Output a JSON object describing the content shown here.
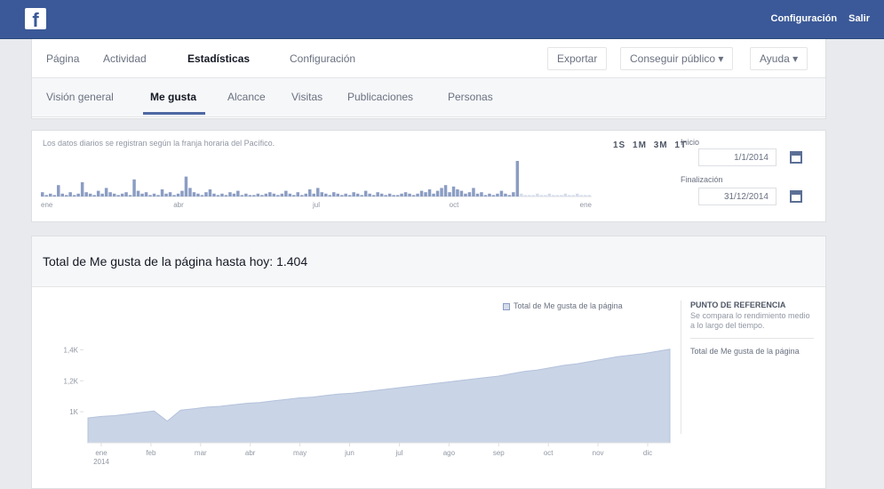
{
  "topbar": {
    "logo_letter": "f",
    "links": [
      "Configuración",
      "Salir"
    ]
  },
  "page_nav": {
    "items": [
      "Página",
      "Actividad",
      "Estadísticas",
      "Configuración"
    ],
    "active": "Estadísticas",
    "buttons": [
      "Exportar",
      "Conseguir público ▾",
      "Ayuda ▾"
    ]
  },
  "insights_tabs": {
    "items": [
      "Visión general",
      "Me gusta",
      "Alcance",
      "Visitas",
      "Publicaciones",
      "Personas"
    ],
    "active": "Me gusta"
  },
  "timeline": {
    "note": "Los datos diarios se registran según la franja horaria del Pacífico.",
    "ranges": [
      "1S",
      "1M",
      "3M",
      "1T"
    ],
    "start_label": "Inicio",
    "start_value": "1/1/2014",
    "end_label": "Finalización",
    "end_value": "31/12/2014",
    "axis_labels": [
      "ene",
      "abr",
      "jul",
      "oct",
      "ene"
    ],
    "daily_values": [
      3,
      1,
      2,
      1,
      8,
      2,
      1,
      3,
      1,
      2,
      10,
      3,
      2,
      1,
      4,
      2,
      6,
      3,
      2,
      1,
      2,
      3,
      1,
      12,
      4,
      2,
      3,
      1,
      2,
      1,
      5,
      2,
      3,
      1,
      2,
      4,
      14,
      6,
      3,
      2,
      1,
      3,
      5,
      2,
      1,
      2,
      1,
      3,
      2,
      4,
      1,
      2,
      1,
      1,
      2,
      1,
      2,
      3,
      2,
      1,
      2,
      4,
      2,
      1,
      3,
      1,
      2,
      5,
      2,
      6,
      3,
      2,
      1,
      3,
      2,
      1,
      2,
      1,
      3,
      2,
      1,
      4,
      2,
      1,
      3,
      2,
      1,
      2,
      1,
      1,
      2,
      3,
      2,
      1,
      2,
      4,
      3,
      5,
      2,
      4,
      6,
      8,
      3,
      7,
      5,
      4,
      2,
      3,
      6,
      2,
      3,
      1,
      2,
      1,
      2,
      4,
      2,
      1,
      3,
      25,
      2,
      1,
      1,
      1,
      2,
      1,
      1,
      2,
      1,
      1,
      1,
      2,
      1,
      1,
      2,
      1,
      1,
      1
    ]
  },
  "main": {
    "title": "Total de Me gusta de la página hasta hoy: 1.404",
    "legend": "Total de Me gusta de la página",
    "side_head": "PUNTO DE REFERENCIA",
    "side_text": "Se compara lo rendimiento medio a lo largo del tiempo.",
    "side_link": "Total de Me gusta de la página"
  },
  "chart_data": {
    "type": "area",
    "title": "Total de Me gusta de la página hasta hoy: 1.404",
    "series": [
      {
        "name": "Total de Me gusta de la página",
        "values": [
          960,
          970,
          975,
          985,
          995,
          1005,
          940,
          1010,
          1020,
          1030,
          1035,
          1045,
          1055,
          1060,
          1070,
          1080,
          1090,
          1095,
          1105,
          1115,
          1120,
          1130,
          1140,
          1150,
          1160,
          1170,
          1180,
          1190,
          1200,
          1210,
          1220,
          1230,
          1245,
          1260,
          1270,
          1285,
          1300,
          1310,
          1325,
          1340,
          1355,
          1365,
          1375,
          1390,
          1404
        ]
      }
    ],
    "y_ticks": [
      "1,4K",
      "1,2K",
      "1K"
    ],
    "x_labels": [
      "ene\n2014",
      "feb",
      "mar",
      "abr",
      "may",
      "jun",
      "jul",
      "ago",
      "sep",
      "oct",
      "nov",
      "dic"
    ],
    "ylim": [
      800,
      1500
    ],
    "grid": false,
    "legend": "top-right",
    "colors": {
      "fill": "#c9d4e6",
      "stroke": "#b4c2dc"
    }
  }
}
